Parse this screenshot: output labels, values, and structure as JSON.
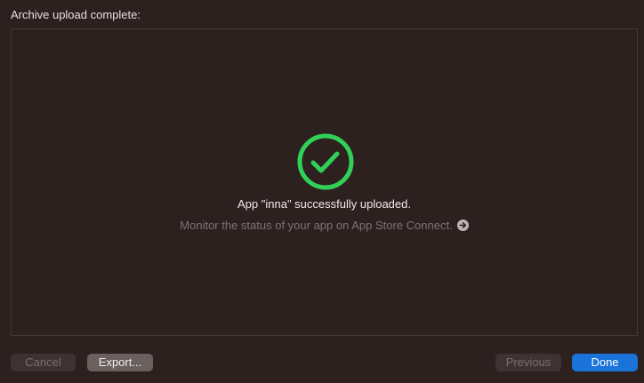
{
  "dialog": {
    "title": "Archive upload complete:"
  },
  "status": {
    "icon": "checkmark-circle-icon",
    "icon_color": "#30d158",
    "message": "App \"inna\" successfully uploaded.",
    "monitor_text": "Monitor the status of your app on App Store Connect.",
    "monitor_icon": "arrow-right-circle-icon"
  },
  "buttons": {
    "cancel": "Cancel",
    "export": "Export...",
    "previous": "Previous",
    "done": "Done"
  },
  "colors": {
    "background": "#2d2120",
    "accent": "#1a73d9"
  }
}
